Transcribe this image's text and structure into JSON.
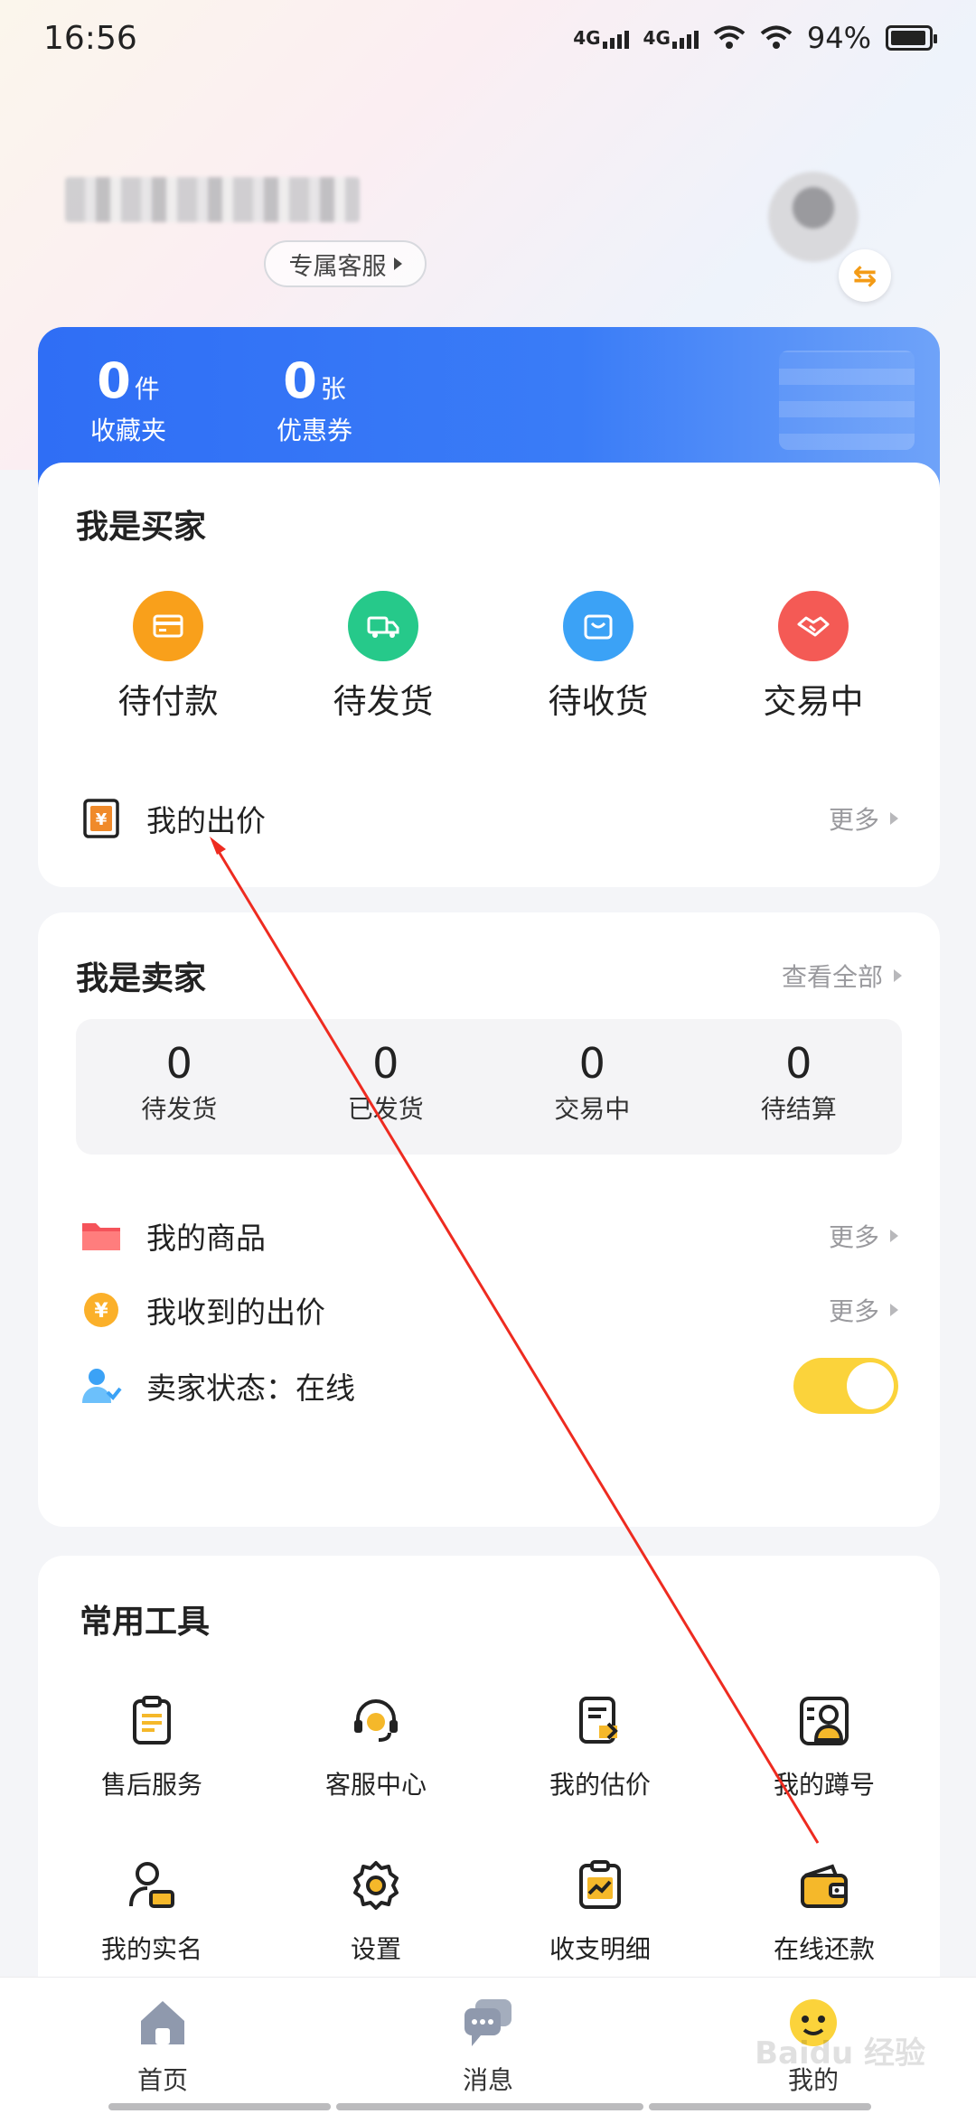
{
  "status_bar": {
    "time": "16:56",
    "network1": "4G",
    "network2": "4G",
    "battery": "94%",
    "battery_level": 0.94
  },
  "header": {
    "service_button": "专属客服"
  },
  "assets": [
    {
      "num": "0",
      "unit": "件",
      "label": "收藏夹"
    },
    {
      "num": "0",
      "unit": "张",
      "label": "优惠券"
    }
  ],
  "buyer": {
    "title": "我是买家",
    "orders": [
      {
        "label": "待付款",
        "icon": "wallet-icon",
        "color": "#f9a01b"
      },
      {
        "label": "待发货",
        "icon": "truck-icon",
        "color": "#26c98a"
      },
      {
        "label": "待收货",
        "icon": "bag-icon",
        "color": "#3ba2f6"
      },
      {
        "label": "交易中",
        "icon": "handshake-icon",
        "color": "#f45a55"
      }
    ],
    "my_bid": {
      "label": "我的出价",
      "more": "更多"
    }
  },
  "seller": {
    "title": "我是卖家",
    "view_all": "查看全部",
    "stats": [
      {
        "num": "0",
        "label": "待发货"
      },
      {
        "num": "0",
        "label": "已发货"
      },
      {
        "num": "0",
        "label": "交易中"
      },
      {
        "num": "0",
        "label": "待结算"
      }
    ],
    "rows": [
      {
        "label": "我的商品",
        "more": "更多"
      },
      {
        "label": "我收到的出价",
        "more": "更多"
      }
    ],
    "status_label": "卖家状态：在线"
  },
  "tools": {
    "title": "常用工具",
    "items": [
      {
        "label": "售后服务",
        "icon": "clipboard-icon"
      },
      {
        "label": "客服中心",
        "icon": "headset-icon"
      },
      {
        "label": "我的估价",
        "icon": "appraisal-icon"
      },
      {
        "label": "我的蹲号",
        "icon": "watch-user-icon"
      },
      {
        "label": "我的实名",
        "icon": "id-user-icon"
      },
      {
        "label": "设置",
        "icon": "settings-gear-icon"
      },
      {
        "label": "收支明细",
        "icon": "ledger-chart-icon"
      },
      {
        "label": "在线还款",
        "icon": "wallet-card-icon"
      }
    ]
  },
  "bottom_nav": [
    {
      "label": "首页",
      "icon": "home-icon"
    },
    {
      "label": "消息",
      "icon": "message-icon"
    },
    {
      "label": "我的",
      "icon": "smiley-icon"
    }
  ],
  "watermark": "Baidu 经验"
}
